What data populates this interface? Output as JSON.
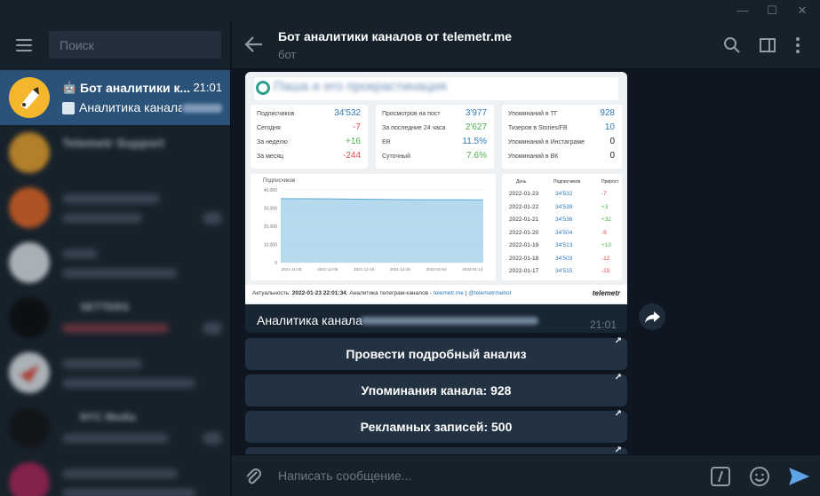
{
  "titlebar": {
    "minimize": "—",
    "maximize": "☐",
    "close": "✕"
  },
  "sidebar": {
    "search_placeholder": "Поиск",
    "chats": [
      {
        "name": "Бот аналитики к...",
        "time": "21:01",
        "preview": "Аналитика канала",
        "active": true
      },
      {
        "name": "Telemetr Support",
        "time": "",
        "preview": "",
        "active": false
      },
      {
        "name": "",
        "time": "",
        "preview": "",
        "active": false
      },
      {
        "name": "",
        "time": "",
        "preview": "",
        "active": false
      },
      {
        "name": "SETTERS",
        "time": "",
        "preview": "",
        "active": false
      },
      {
        "name": "",
        "time": "",
        "preview": "",
        "active": false
      },
      {
        "name": "NYC Media",
        "time": "",
        "preview": "",
        "active": false
      },
      {
        "name": "",
        "time": "",
        "preview": "",
        "active": false
      }
    ]
  },
  "header": {
    "title": "Бот аналитики каналов от telemetr.me",
    "subtitle": "бот"
  },
  "card": {
    "title": "Паша и его прокрастинация",
    "panel1": [
      {
        "label": "Подписчиков",
        "value": "34'532",
        "cls": "blu"
      },
      {
        "label": "Сегодня",
        "value": "-7",
        "cls": "neg"
      },
      {
        "label": "За неделю",
        "value": "+16",
        "cls": "pos"
      },
      {
        "label": "За месяц",
        "value": "-244",
        "cls": "neg"
      }
    ],
    "panel2": [
      {
        "label": "Просмотров на пост",
        "value": "3'977",
        "cls": "blu"
      },
      {
        "label": "За последние 24 часа",
        "value": "2'627",
        "cls": "pos"
      },
      {
        "label": "ER",
        "value": "11.5%",
        "cls": "blu"
      },
      {
        "label": "Суточный",
        "value": "7.6%",
        "cls": "pos"
      }
    ],
    "panel3": [
      {
        "label": "Упоминаний в ТГ",
        "value": "928",
        "cls": "blu"
      },
      {
        "label": "Тизеров в Stories/FB",
        "value": "10",
        "cls": "blu"
      },
      {
        "label": "Упоминаний в Инстаграме",
        "value": "0",
        "cls": "blk"
      },
      {
        "label": "Упоминаний в ВК",
        "value": "0",
        "cls": "blk"
      }
    ],
    "chart_title": "Подписчиков",
    "table_headers": [
      "День",
      "Подписчиков",
      "Прирост"
    ],
    "table_rows": [
      [
        "2022-01-23",
        "34'532",
        "-7"
      ],
      [
        "2022-01-22",
        "34'539",
        "+3"
      ],
      [
        "2022-01-21",
        "34'536",
        "+32"
      ],
      [
        "2022-01-20",
        "34'504",
        "-9"
      ],
      [
        "2022-01-19",
        "34'513",
        "+10"
      ],
      [
        "2022-01-18",
        "34'503",
        "-12"
      ],
      [
        "2022-01-17",
        "34'515",
        "-15"
      ]
    ],
    "footer_prefix": "Актуальность: ",
    "footer_date": "2022-01-23 22:01:34",
    "footer_mid": ". Аналитика телеграм-каналов - ",
    "footer_link1": "telemetr.me",
    "footer_sep": " | ",
    "footer_link2": "@telemetrmebot",
    "logo": "telemetr"
  },
  "chart_data": {
    "type": "area",
    "title": "Подписчиков",
    "x": [
      "2021-11-25",
      "2021-12-05",
      "2021-12-15",
      "2021-12-25",
      "2022-01-04",
      "2022-01-14"
    ],
    "values": [
      35200,
      35150,
      35050,
      34900,
      34750,
      34650,
      34600,
      34550,
      34532
    ],
    "y_ticks": [
      "40,000",
      "30,000",
      "20,000",
      "10,000",
      "0"
    ],
    "ylim": [
      0,
      40000
    ],
    "color": "#a9d4ea"
  },
  "message": {
    "caption": "Аналитика канала",
    "time": "21:01"
  },
  "buttons": [
    {
      "label": "Провести подробный анализ"
    },
    {
      "label": "Упоминания канала: 928"
    },
    {
      "label": "Рекламных записей: 500"
    }
  ],
  "input": {
    "placeholder": "Написать сообщение..."
  }
}
